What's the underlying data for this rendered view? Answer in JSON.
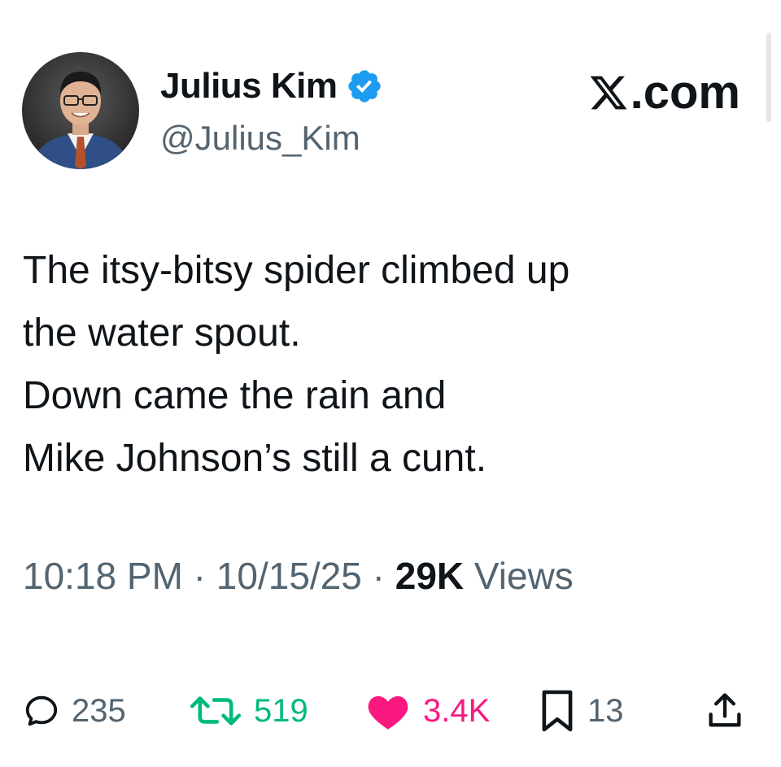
{
  "author": {
    "display_name": "Julius Kim",
    "handle": "@Julius_Kim",
    "verified": true,
    "verified_color": "#1d9bf0"
  },
  "brand": {
    "label": ".com",
    "icon": "x-logo-icon"
  },
  "tweet": {
    "lines": [
      "The itsy-bitsy spider climbed up",
      "the water spout.",
      "Down came the rain and",
      "Mike Johnson’s still a cunt."
    ]
  },
  "meta": {
    "time": "10:18 PM",
    "separator": " · ",
    "date": "10/15/25",
    "views_count": "29K",
    "views_label": "Views"
  },
  "actions": {
    "replies": "235",
    "retweets": "519",
    "likes": "3.4K",
    "bookmarks": "13"
  },
  "colors": {
    "text": "#0f1419",
    "secondary": "#536471",
    "retweet": "#00ba7c",
    "like": "#f91880"
  }
}
